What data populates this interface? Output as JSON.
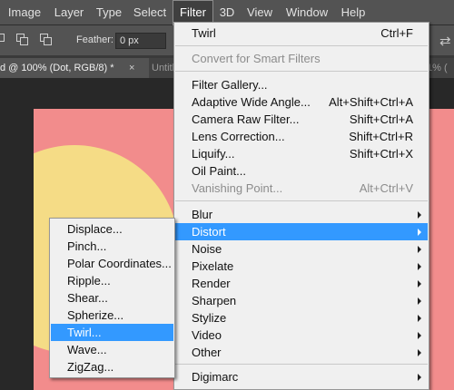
{
  "menubar": {
    "items": [
      "Image",
      "Layer",
      "Type",
      "Select",
      "Filter",
      "3D",
      "View",
      "Window",
      "Help"
    ],
    "active": "Filter"
  },
  "options": {
    "feather_label": "Feather:",
    "feather_value": "0 px"
  },
  "tabs": {
    "active": "d @ 100% (Dot, RGB/8) *",
    "active_close": "×",
    "inactive": "Untitl",
    "right": "1% ("
  },
  "filter_menu": {
    "last_filter": {
      "label": "Twirl",
      "shortcut": "Ctrl+F"
    },
    "convert": "Convert for Smart Filters",
    "group2": [
      {
        "label": "Filter Gallery...",
        "shortcut": "",
        "disabled": false
      },
      {
        "label": "Adaptive Wide Angle...",
        "shortcut": "Alt+Shift+Ctrl+A",
        "disabled": false
      },
      {
        "label": "Camera Raw Filter...",
        "shortcut": "Shift+Ctrl+A",
        "disabled": false
      },
      {
        "label": "Lens Correction...",
        "shortcut": "Shift+Ctrl+R",
        "disabled": false
      },
      {
        "label": "Liquify...",
        "shortcut": "Shift+Ctrl+X",
        "disabled": false
      },
      {
        "label": "Oil Paint...",
        "shortcut": "",
        "disabled": false
      },
      {
        "label": "Vanishing Point...",
        "shortcut": "Alt+Ctrl+V",
        "disabled": true
      }
    ],
    "submenus": [
      "Blur",
      "Distort",
      "Noise",
      "Pixelate",
      "Render",
      "Sharpen",
      "Stylize",
      "Video",
      "Other"
    ],
    "highlighted": "Distort",
    "bottom": "Digimarc"
  },
  "distort_menu": {
    "items": [
      "Displace...",
      "Pinch...",
      "Polar Coordinates...",
      "Ripple...",
      "Shear...",
      "Spherize...",
      "Twirl...",
      "Wave...",
      "ZigZag..."
    ],
    "highlighted": "Twirl..."
  },
  "colors": {
    "canvas": "#f28c8c",
    "sun": "#f5dc86",
    "menu_highlight": "#3399ff",
    "menu_bg": "#f0f0f0",
    "ui_dark": "#535353"
  },
  "icons": [
    "selection-new-icon",
    "selection-add-icon",
    "selection-intersect-icon",
    "submenu-arrow-icon",
    "refresh-icon"
  ]
}
